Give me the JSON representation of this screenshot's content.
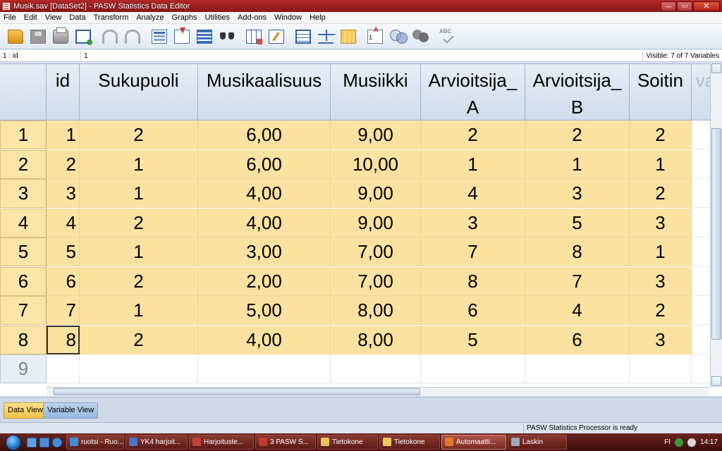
{
  "window": {
    "title": "Musik.sav [DataSet2] - PASW Statistics Data Editor",
    "buttons": {
      "minimize": "—",
      "maximize": "▭",
      "close": "✕"
    }
  },
  "menu": [
    "File",
    "Edit",
    "View",
    "Data",
    "Transform",
    "Analyze",
    "Graphs",
    "Utilities",
    "Add-ons",
    "Window",
    "Help"
  ],
  "toolbar": [
    "open-icon",
    "save-icon",
    "print-icon",
    "dialog-recall-icon",
    "undo-icon",
    "redo-icon",
    "goto-case-icon",
    "goto-variable-icon",
    "variables-icon",
    "find-icon",
    "insert-cases-icon",
    "insert-variable-icon",
    "split-file-icon",
    "weight-cases-icon",
    "select-cases-icon",
    "value-labels-icon",
    "use-sets-icon",
    "show-all-variables-icon",
    "spelling-icon"
  ],
  "cell_editor": {
    "reference": "1 : id",
    "value": "1",
    "visible": "Visible: 7 of 7 Variables"
  },
  "grid": {
    "columns": [
      "id",
      "Sukupuoli",
      "Musikaalisuus",
      "Musiikki",
      "Arvioitsija_ A",
      "Arvioitsija_ B",
      "Soitin",
      "va"
    ],
    "rows": [
      {
        "n": "1",
        "cells": [
          "1",
          "2",
          "6,00",
          "9,00",
          "2",
          "2",
          "2"
        ]
      },
      {
        "n": "2",
        "cells": [
          "2",
          "1",
          "6,00",
          "10,00",
          "1",
          "1",
          "1"
        ]
      },
      {
        "n": "3",
        "cells": [
          "3",
          "1",
          "4,00",
          "9,00",
          "4",
          "3",
          "2"
        ]
      },
      {
        "n": "4",
        "cells": [
          "4",
          "2",
          "4,00",
          "9,00",
          "3",
          "5",
          "3"
        ]
      },
      {
        "n": "5",
        "cells": [
          "5",
          "1",
          "3,00",
          "7,00",
          "7",
          "8",
          "1"
        ]
      },
      {
        "n": "6",
        "cells": [
          "6",
          "2",
          "2,00",
          "7,00",
          "8",
          "7",
          "3"
        ]
      },
      {
        "n": "7",
        "cells": [
          "7",
          "1",
          "5,00",
          "8,00",
          "6",
          "4",
          "2"
        ]
      },
      {
        "n": "8",
        "cells": [
          "8",
          "2",
          "4,00",
          "8,00",
          "5",
          "6",
          "3"
        ]
      }
    ],
    "empty_row": "9",
    "active_cell": "row 8, id"
  },
  "tabs": {
    "data_view": "Data View",
    "variable_view": "Variable View",
    "active": "Data View"
  },
  "status": {
    "message": "PASW Statistics Processor is ready"
  },
  "taskbar": {
    "tasks": [
      {
        "label": "ruotsi - Ruo...",
        "color": "#3d8fd8"
      },
      {
        "label": "YK4 harjoit...",
        "color": "#4a74c4"
      },
      {
        "label": "Harjoituste...",
        "color": "#c2423a"
      },
      {
        "label": "3 PASW S...",
        "color": "#c23a30"
      },
      {
        "label": "Tietokone",
        "color": "#e8c85a"
      },
      {
        "label": "Tietokone",
        "color": "#e8c85a"
      },
      {
        "label": "Automaatti...",
        "color": "#e07a2a"
      },
      {
        "label": "Laskin",
        "color": "#9aa8b8"
      }
    ],
    "active_task": "Automaatti...",
    "language": "FI",
    "clock": "14:17"
  }
}
